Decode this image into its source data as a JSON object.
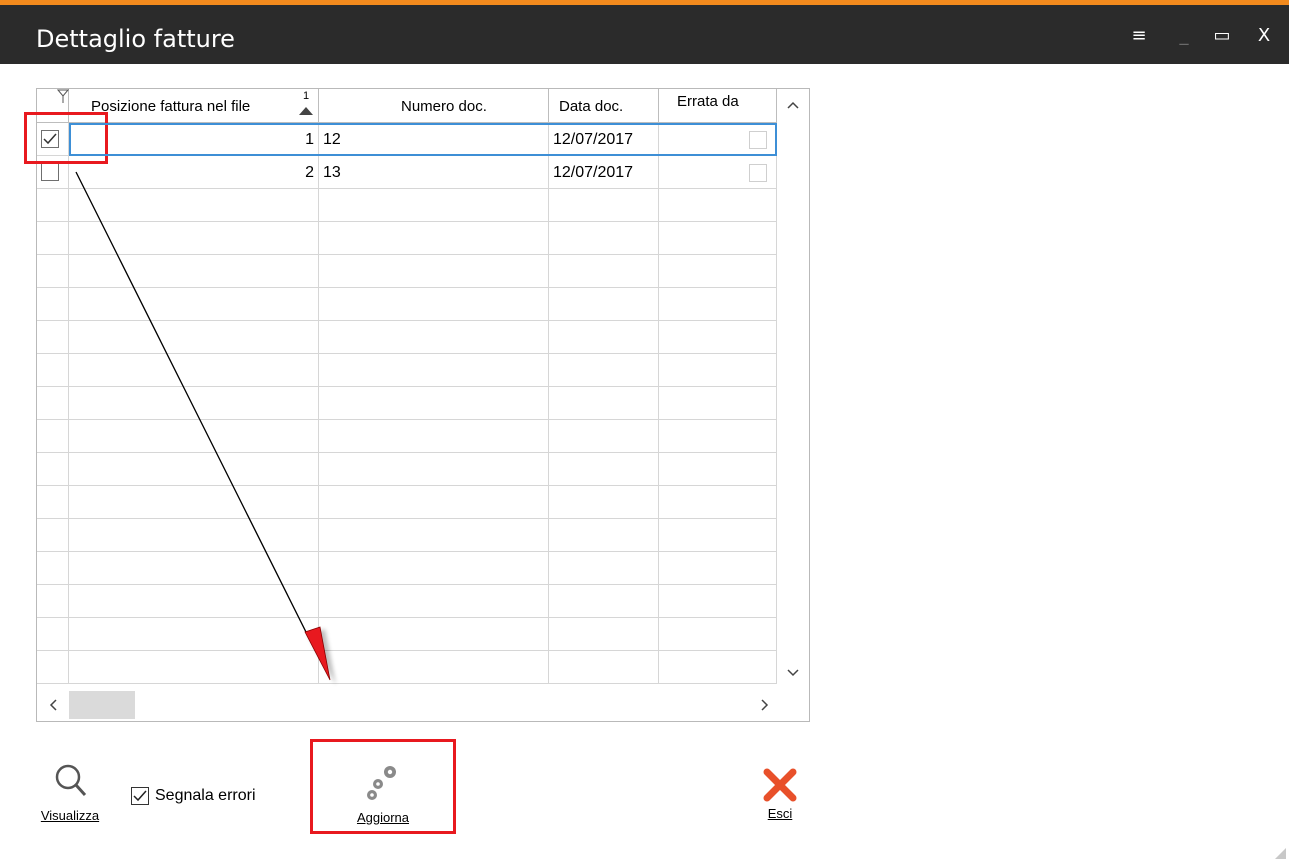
{
  "window": {
    "title": "Dettaglio fatture",
    "controls": {
      "menu": "≡",
      "minimize": "_",
      "maximize": "▭",
      "close": "X"
    },
    "accent_color": "#f28a1d"
  },
  "grid": {
    "columns": [
      {
        "label": "Posizione fattura nel file",
        "sort_indicator": "1"
      },
      {
        "label": "Numero doc."
      },
      {
        "label": "Data doc."
      },
      {
        "label": "Errata da"
      }
    ],
    "rows": [
      {
        "selected": true,
        "posizione": "1",
        "numero": "12",
        "data": "12/07/2017",
        "errata": false
      },
      {
        "selected": false,
        "posizione": "2",
        "numero": "13",
        "data": "12/07/2017",
        "errata": false
      }
    ]
  },
  "toolbar": {
    "visualizza_label": "Visualizza",
    "segnala_errori_label": "Segnala errori",
    "segnala_errori_checked": true,
    "aggiorna_label": "Aggiorna",
    "esci_label": "Esci"
  },
  "annotation_color": "#e8191f"
}
